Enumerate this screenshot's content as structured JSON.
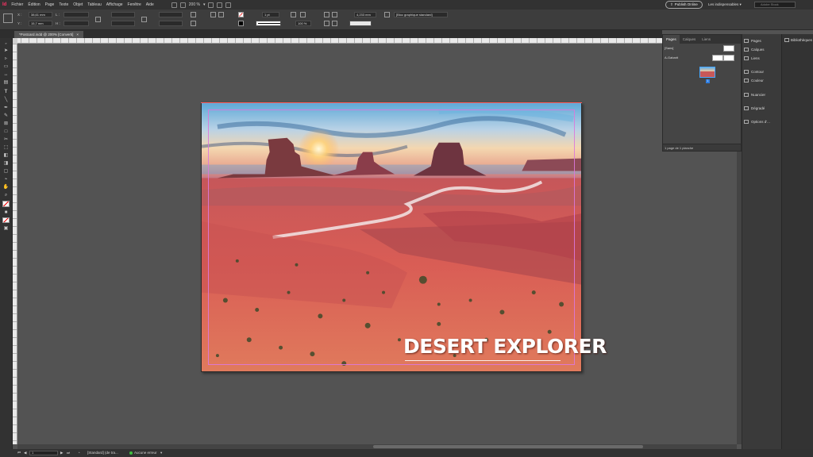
{
  "menubar": {
    "logo": "Id",
    "items": [
      "Fichier",
      "Édition",
      "Page",
      "Texte",
      "Objet",
      "Tableau",
      "Affichage",
      "Fenêtre",
      "Aide"
    ],
    "zoom": "200 %",
    "publish_label": "Publish Online",
    "workspace": "Les indispensables",
    "search_placeholder": "Adobe Stock"
  },
  "controlbar": {
    "x_label": "X :",
    "x_value": "38,61 mm",
    "y_label": "Y :",
    "y_value": "15,7 mm",
    "l_label": "L :",
    "h_label": "H :",
    "stroke_weight": "1 pt",
    "zoom_pct": "100 %",
    "gap_value": "4,233 mm",
    "frame_style": "[Bloc graphique standard]"
  },
  "document_tab": {
    "title": "*Postcard.indd @ 200% [Converti]",
    "close": "×"
  },
  "poster": {
    "title": "DESERT EXPLORER"
  },
  "pages_panel": {
    "tabs": [
      "Pages",
      "Calques",
      "Liens"
    ],
    "none_label": "[Sans]",
    "master_label": "A-Gabarit",
    "page_number": "1",
    "footer": "1 page de 1 planche"
  },
  "dock": {
    "items": [
      "Pages",
      "Calques",
      "Liens",
      "Contour",
      "Couleur",
      "Nuancier",
      "Dégradé",
      "Options d'..."
    ],
    "library": "Bibliothèques"
  },
  "statusbar": {
    "page_field": "1",
    "preflight_profile": "[Standard] (de tra...",
    "errors": "Aucune erreur"
  },
  "colors": {
    "ui_dark": "#323232",
    "pasteboard": "#535353",
    "accent_blue": "#2e7de0",
    "logo_pink": "#ff3366",
    "ok_green": "#3fbf3f"
  }
}
